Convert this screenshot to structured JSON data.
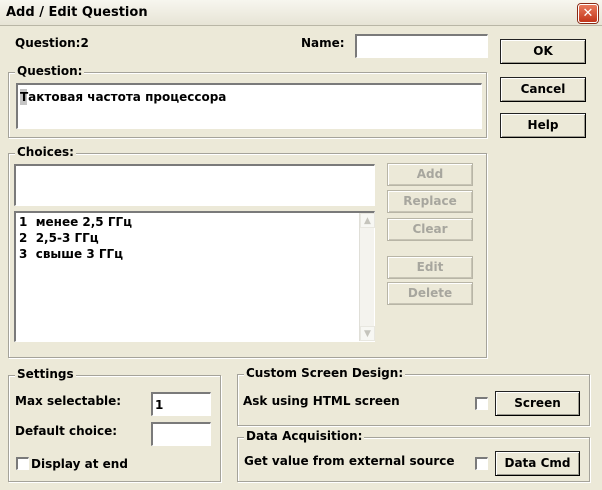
{
  "window": {
    "title": "Add / Edit Question",
    "close_symbol": "✕"
  },
  "header": {
    "question_label": "Question:2",
    "name_label": "Name:",
    "name_value": ""
  },
  "buttons": {
    "ok": "OK",
    "cancel": "Cancel",
    "help": "Help"
  },
  "question": {
    "legend": "Question:",
    "text": "Тактовая частота процессора"
  },
  "choices": {
    "legend": "Choices:",
    "input_value": "",
    "items": [
      "1  менее 2,5 ГГц",
      "2  2,5-3 ГГц",
      "3  свыше 3 ГГц"
    ],
    "buttons": {
      "add": "Add",
      "replace": "Replace",
      "clear": "Clear",
      "edit": "Edit",
      "delete": "Delete"
    }
  },
  "settings": {
    "legend": "Settings",
    "max_selectable_label": "Max selectable:",
    "max_selectable_value": "1",
    "default_choice_label": "Default choice:",
    "default_choice_value": "",
    "display_at_end_label": "Display at end",
    "display_at_end_checked": false
  },
  "custom_screen": {
    "legend": "Custom Screen Design:",
    "ask_html_label": "Ask using HTML screen",
    "ask_html_checked": false,
    "screen_button": "Screen"
  },
  "data_acquisition": {
    "legend": "Data Acquisition:",
    "external_label": "Get value from external source",
    "external_checked": false,
    "data_cmd_button": "Data Cmd"
  },
  "icons": {
    "scroll_up": "chevron-up-icon",
    "scroll_down": "chevron-down-icon",
    "close": "close-icon"
  }
}
